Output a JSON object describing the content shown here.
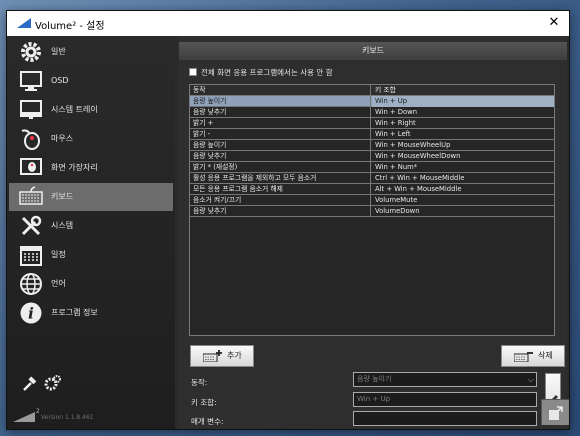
{
  "window": {
    "title": "Volume² - 설정",
    "close_glyph": "✕"
  },
  "sidebar": {
    "items": [
      {
        "label": "일반",
        "icon": "gear-icon"
      },
      {
        "label": "OSD",
        "icon": "monitor-icon"
      },
      {
        "label": "시스템 트레이",
        "icon": "system-tray-icon"
      },
      {
        "label": "마우스",
        "icon": "mouse-icon"
      },
      {
        "label": "화면 가장자리",
        "icon": "screen-edge-icon"
      },
      {
        "label": "키보드",
        "icon": "keyboard-icon"
      },
      {
        "label": "시스템",
        "icon": "tools-icon"
      },
      {
        "label": "일정",
        "icon": "calendar-icon"
      },
      {
        "label": "언어",
        "icon": "globe-icon"
      },
      {
        "label": "프로그램 정보",
        "icon": "info-icon"
      }
    ],
    "active_index": 5,
    "version": "Version 1.1.8.461"
  },
  "main": {
    "header": "키보드",
    "fullscreen_checkbox_label": "전체 화면 응용 프로그램에서는 사용 안 함",
    "table": {
      "columns": [
        "동작",
        "키 조합"
      ],
      "rows": [
        [
          "음량 높이기",
          "Win + Up"
        ],
        [
          "음량 낮추기",
          "Win + Down"
        ],
        [
          "밝기 +",
          "Win + Right"
        ],
        [
          "밝기 -",
          "Win + Left"
        ],
        [
          "음량 높이기",
          "Win + MouseWheelUp"
        ],
        [
          "음량 낮추기",
          "Win + MouseWheelDown"
        ],
        [
          "밝기 * (재설정)",
          "Win + Num*"
        ],
        [
          "활성 응용 프로그램을 제외하고 모두 음소거",
          "Ctrl + Win + MouseMiddle"
        ],
        [
          "모든 응용 프로그램 음소거 해제",
          "Alt + Win + MouseMiddle"
        ],
        [
          "음소거 켜기/끄기",
          "VolumeMute"
        ],
        [
          "음량 낮추기",
          "VolumeDown"
        ]
      ],
      "selected_index": 0
    },
    "add_button": "추가",
    "delete_button": "삭제",
    "action_label": "동작:",
    "action_value": "음량 높이기",
    "key_label": "키 조합:",
    "key_value": "Win + Up",
    "param_label": "매개 변수:",
    "param_value": ""
  }
}
